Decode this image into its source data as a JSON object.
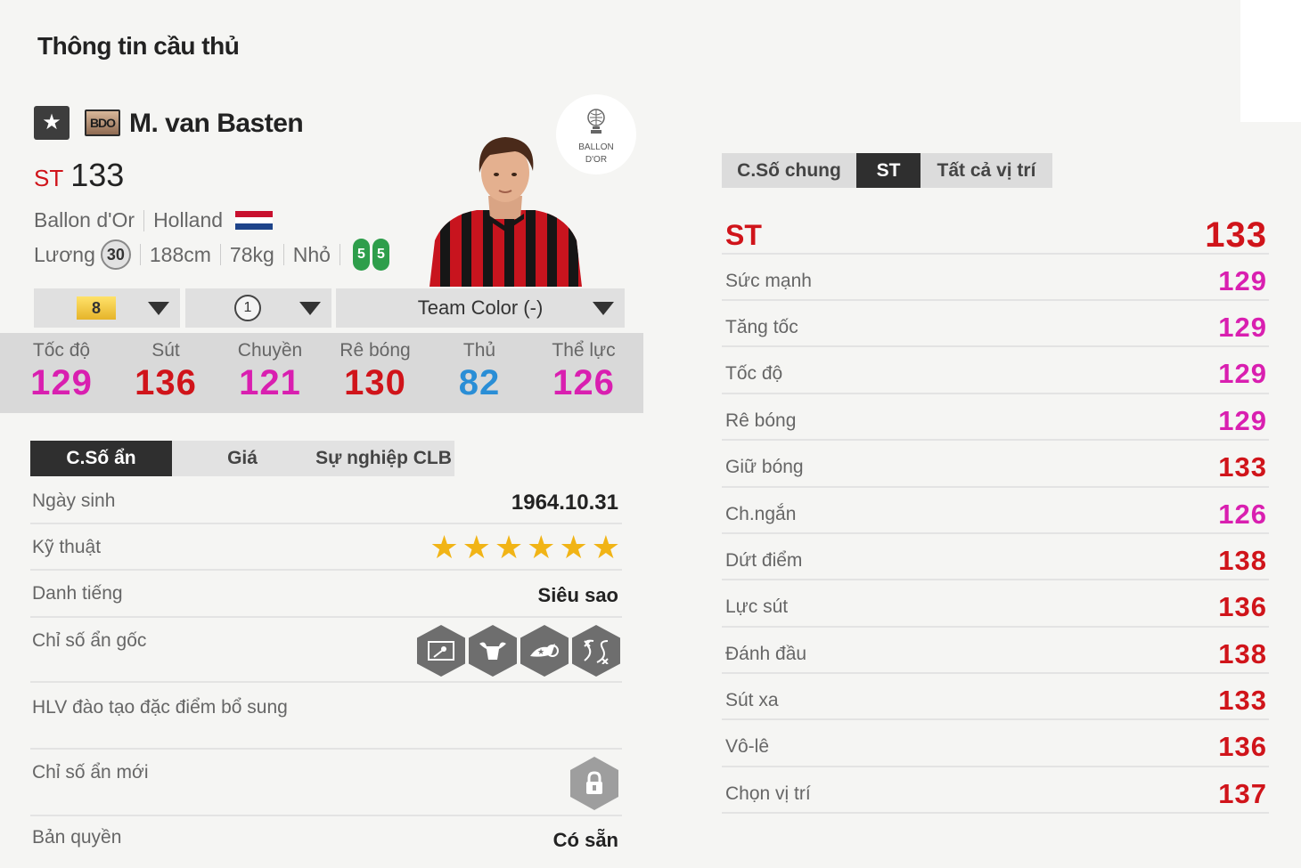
{
  "page_title": "Thông tin cầu thủ",
  "player": {
    "star_icon": "★",
    "season_badge": "BDO",
    "name": "M. van Basten",
    "position": "ST",
    "ovr": "133",
    "club_season": "Ballon d'Or",
    "nation": "Holland",
    "salary_label": "Lương",
    "salary": "30",
    "height": "188cm",
    "weight": "78kg",
    "body": "Nhỏ",
    "left_foot": "5",
    "right_foot": "5",
    "logo_line1": "BALLON",
    "logo_line2": "D'OR"
  },
  "selectors": {
    "level": "8",
    "rank": "1",
    "team_color": "Team Color (-)"
  },
  "stats": [
    {
      "label": "Tốc độ",
      "value": "129",
      "color": "#d91fb0"
    },
    {
      "label": "Sút",
      "value": "136",
      "color": "#d0141a"
    },
    {
      "label": "Chuyền",
      "value": "121",
      "color": "#d91fb0"
    },
    {
      "label": "Rê bóng",
      "value": "130",
      "color": "#d0141a"
    },
    {
      "label": "Thủ",
      "value": "82",
      "color": "#2a8ed6"
    },
    {
      "label": "Thể lực",
      "value": "126",
      "color": "#d91fb0"
    }
  ],
  "left_tabs": [
    "C.Số ẩn",
    "Giá",
    "Sự nghiệp CLB"
  ],
  "details": {
    "birth_label": "Ngày sinh",
    "birth_value": "1964.10.31",
    "skill_label": "Kỹ thuật",
    "skill_stars": 6,
    "rep_label": "Danh tiếng",
    "rep_value": "Siêu sao",
    "traits_label": "Chỉ số ẩn gốc",
    "trait_icons": [
      "finesse-shot-icon",
      "bull-icon",
      "speed-dribbler-icon",
      "playmaker-icon"
    ],
    "coach_label": "HLV đào tạo đặc điểm bổ sung",
    "new_traits_label": "Chỉ số ẩn mới",
    "license_label": "Bản quyền",
    "license_value": "Có sẵn"
  },
  "right_tabs": [
    "C.Số chung",
    "ST",
    "Tất cả vị trí"
  ],
  "position_stats": {
    "header_label": "ST",
    "header_value": "133",
    "rows": [
      {
        "label": "Sức mạnh",
        "value": "129",
        "color": "#d91fb0"
      },
      {
        "label": "Tăng tốc",
        "value": "129",
        "color": "#d91fb0"
      },
      {
        "label": "Tốc độ",
        "value": "129",
        "color": "#d91fb0"
      },
      {
        "label": "Rê bóng",
        "value": "129",
        "color": "#d91fb0"
      },
      {
        "label": "Giữ bóng",
        "value": "133",
        "color": "#d0141a"
      },
      {
        "label": "Ch.ngắn",
        "value": "126",
        "color": "#d91fb0"
      },
      {
        "label": "Dứt điểm",
        "value": "138",
        "color": "#d0141a"
      },
      {
        "label": "Lực sút",
        "value": "136",
        "color": "#d0141a"
      },
      {
        "label": "Đánh đầu",
        "value": "138",
        "color": "#d0141a"
      },
      {
        "label": "Sút xa",
        "value": "133",
        "color": "#d0141a"
      },
      {
        "label": "Vô-lê",
        "value": "136",
        "color": "#d0141a"
      },
      {
        "label": "Chọn vị trí",
        "value": "137",
        "color": "#d0141a"
      }
    ]
  }
}
